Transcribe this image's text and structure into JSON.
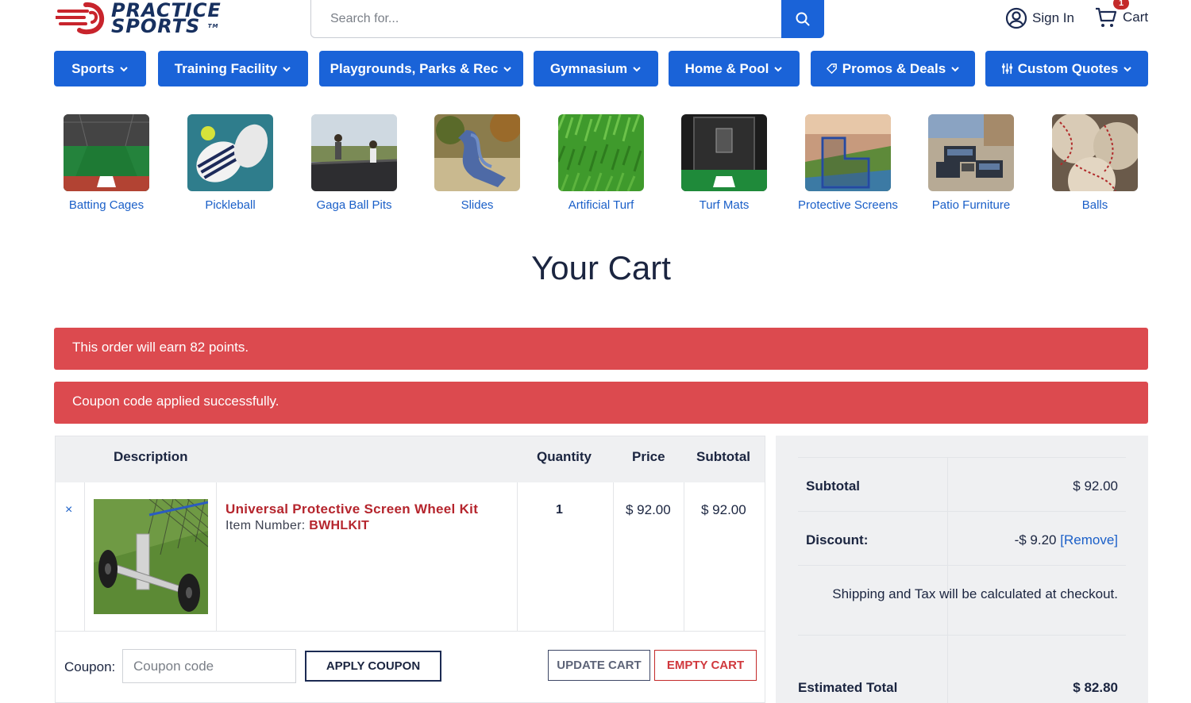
{
  "header": {
    "logo_line1": "PRACTICE",
    "logo_line2": "SPORTS",
    "logo_tm": "TM",
    "search_placeholder": "Search for...",
    "sign_in": "Sign In",
    "cart_label": "Cart",
    "cart_count": "1"
  },
  "nav": [
    {
      "label": "Sports"
    },
    {
      "label": "Training Facility"
    },
    {
      "label": "Playgrounds, Parks & Rec"
    },
    {
      "label": "Gymnasium"
    },
    {
      "label": "Home & Pool"
    },
    {
      "label": "Promos & Deals"
    },
    {
      "label": "Custom Quotes"
    }
  ],
  "categories": [
    {
      "label": "Batting Cages"
    },
    {
      "label": "Pickleball"
    },
    {
      "label": "Gaga Ball Pits"
    },
    {
      "label": "Slides"
    },
    {
      "label": "Artificial Turf"
    },
    {
      "label": "Turf Mats"
    },
    {
      "label": "Protective Screens"
    },
    {
      "label": "Patio Furniture"
    },
    {
      "label": "Balls"
    }
  ],
  "page_title": "Your Cart",
  "alerts": {
    "points": "This order will earn 82 points.",
    "coupon": "Coupon code applied successfully."
  },
  "cart_table": {
    "headers": {
      "description": "Description",
      "quantity": "Quantity",
      "price": "Price",
      "subtotal": "Subtotal"
    },
    "items": [
      {
        "remove": "×",
        "name": "Universal Protective Screen Wheel Kit",
        "sku_label": "Item Number: ",
        "sku": "BWHLKIT",
        "quantity": "1",
        "price": "$ 92.00",
        "subtotal": "$ 92.00"
      }
    ],
    "coupon_label": "Coupon:",
    "coupon_placeholder": "Coupon code",
    "apply_coupon": "APPLY COUPON",
    "update_cart": "UPDATE CART",
    "empty_cart": "EMPTY CART"
  },
  "totals": {
    "subtotal_label": "Subtotal",
    "subtotal_value": "$ 92.00",
    "discount_label": "Discount:",
    "discount_value": "-$ 9.20",
    "discount_remove": "[Remove]",
    "shipping_note": "Shipping and Tax will be calculated at checkout.",
    "estimated_label": "Estimated Total",
    "estimated_value": "$ 82.80"
  },
  "colors": {
    "accent": "#1a63d8",
    "alert": "#dc4a4f",
    "brand_red": "#b5252d",
    "navy": "#17305f"
  }
}
